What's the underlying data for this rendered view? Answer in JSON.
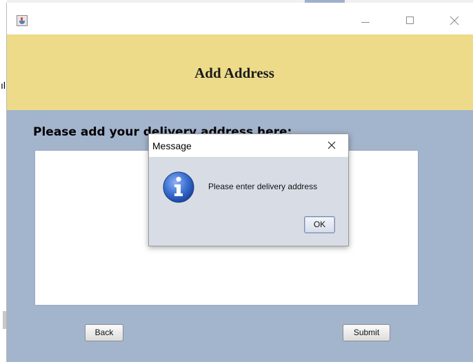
{
  "background": {
    "left_glyph": "ıl"
  },
  "window": {
    "header_title": "Add Address",
    "prompt_label": "Please add your delivery address here:",
    "address_value": "",
    "back_label": "Back",
    "submit_label": "Submit",
    "colors": {
      "header": "#eddb89",
      "body": "#a3b4cd"
    }
  },
  "dialog": {
    "title": "Message",
    "message": "Please enter delivery address",
    "ok_label": "OK",
    "icon": "info-icon"
  }
}
